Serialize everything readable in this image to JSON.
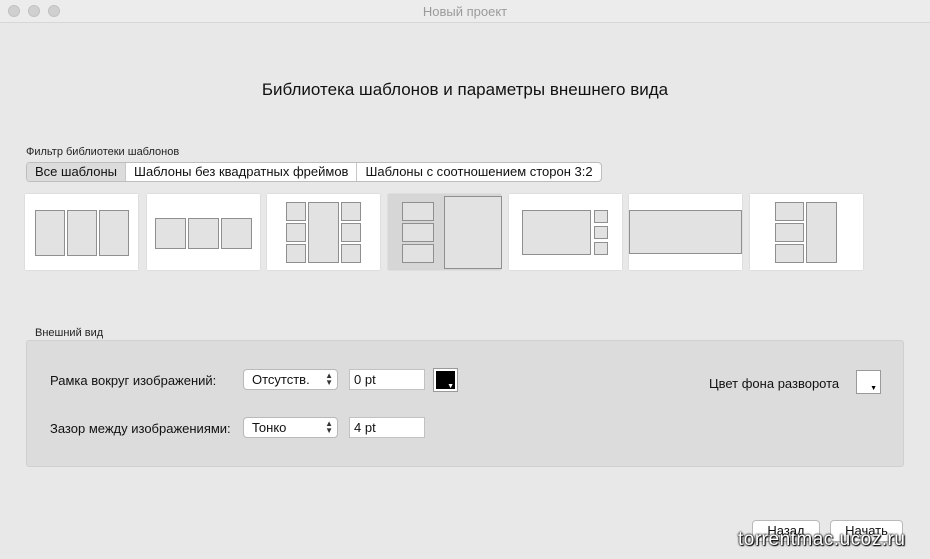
{
  "window": {
    "title": "Новый проект"
  },
  "heading": "Библиотека шаблонов и параметры внешнего вида",
  "filter": {
    "label": "Фильтр библиотеки шаблонов",
    "tabs": [
      {
        "label": "Все шаблоны",
        "selected": true
      },
      {
        "label": "Шаблоны без квадратных фреймов",
        "selected": false
      },
      {
        "label": "Шаблоны с соотношением сторон 3:2",
        "selected": false
      }
    ]
  },
  "templates": [
    {
      "name": "three-vertical",
      "selected": false
    },
    {
      "name": "three-horizontal",
      "selected": false
    },
    {
      "name": "grid-six-center-tall",
      "selected": false
    },
    {
      "name": "stack-left-large-right",
      "selected": true
    },
    {
      "name": "large-left-small-right",
      "selected": false
    },
    {
      "name": "single-wide",
      "selected": false
    },
    {
      "name": "stack-left-tall-right",
      "selected": false
    }
  ],
  "appearance": {
    "label": "Внешний вид",
    "border_label": "Рамка вокруг изображений:",
    "border_style": "Отсутств.",
    "border_width": "0 pt",
    "border_color": "#000000",
    "gap_label": "Зазор между изображениями:",
    "gap_style": "Тонко",
    "gap_width": "4 pt",
    "bg_label": "Цвет фона разворота",
    "bg_color": "#ffffff"
  },
  "buttons": {
    "back": "Назад",
    "start": "Начать"
  },
  "watermark": "torrentmac.ucoz.ru"
}
